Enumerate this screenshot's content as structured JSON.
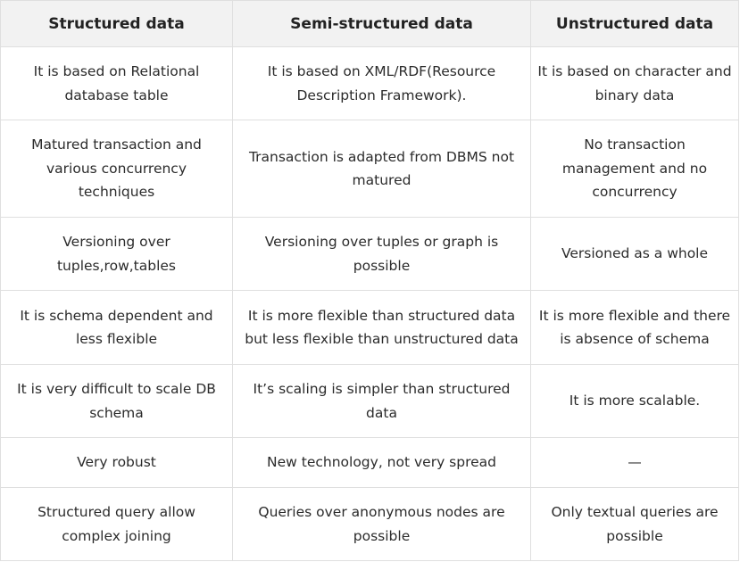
{
  "table": {
    "headers": [
      "Structured data",
      "Semi-structured data",
      "Unstructured data"
    ],
    "rows": [
      [
        "It is based on Relational database table",
        "It is based on XML/RDF(Resource Description Framework).",
        "It is based on character and binary data"
      ],
      [
        "Matured transaction and various concurrency techniques",
        "Transaction is adapted from DBMS not matured",
        "No transaction management and no concurrency"
      ],
      [
        "Versioning over tuples,row,tables",
        "Versioning over tuples or graph is possible",
        "Versioned as a whole"
      ],
      [
        "It is schema dependent and less flexible",
        "It is more flexible than structured data but less flexible than unstructured data",
        "It is more flexible and there is absence of schema"
      ],
      [
        "It is very difficult to scale DB schema",
        "It’s scaling is simpler than structured data",
        "It is more scalable."
      ],
      [
        "Very robust",
        "New technology, not very spread",
        "—"
      ],
      [
        "Structured query allow complex joining",
        "Queries over anonymous nodes are possible",
        "Only textual queries are possible"
      ]
    ]
  },
  "colors": {
    "header_background": "#f2f2f2",
    "border": "#dfdfdf",
    "text": "#222222"
  }
}
